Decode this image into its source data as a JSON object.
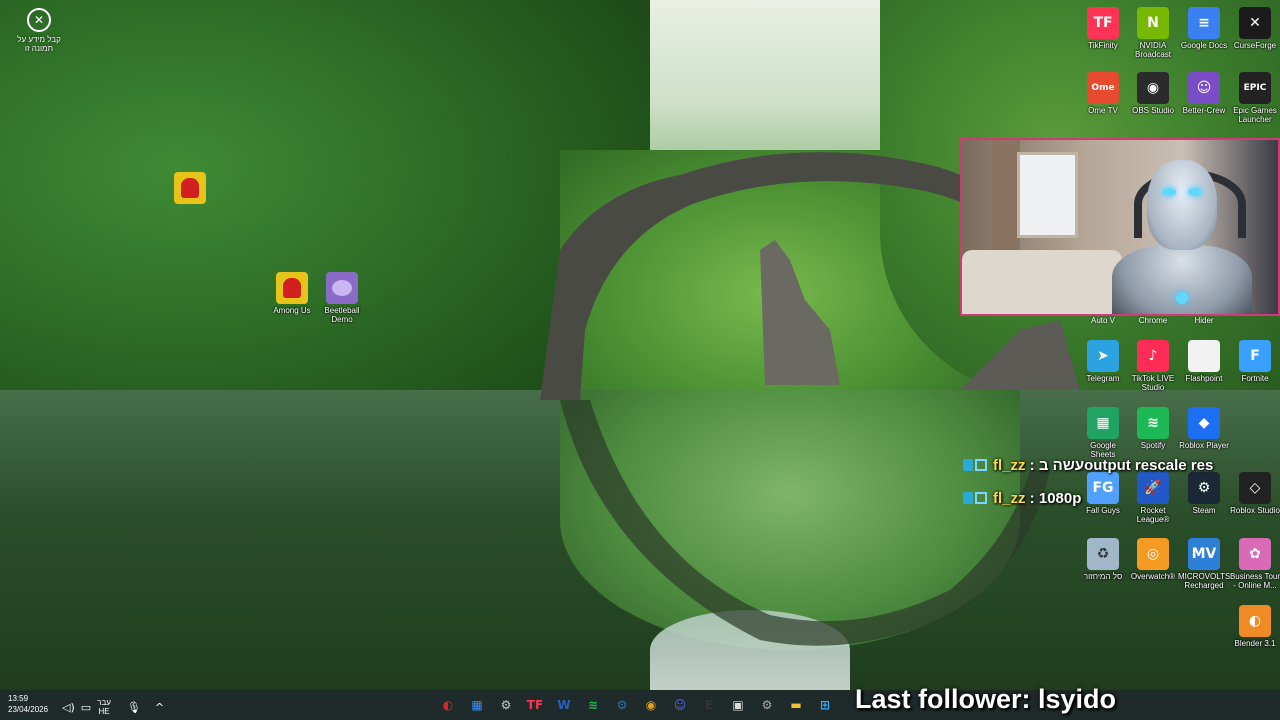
{
  "top_left_icon": {
    "icon": "circle-x-icon",
    "label_line1": "קבל מידע על",
    "label_line2": "תמונה זו"
  },
  "desktop_left": [
    {
      "label": "",
      "icon": "among-us-small-icon",
      "color": "#e8c31a"
    },
    {
      "label": "Among Us",
      "icon": "among-us-icon",
      "color": "#e8c31a"
    },
    {
      "label": "Beetleball Demo",
      "icon": "beetleball-icon",
      "color": "#8a6bc8"
    }
  ],
  "desktop_right": [
    {
      "label": "TikFinity",
      "icon": "tikfinity-icon",
      "glyph": "TF",
      "color": "#ff3355"
    },
    {
      "label": "NVIDIA Broadcast",
      "icon": "nvidia-icon",
      "glyph": "N",
      "color": "#76b900"
    },
    {
      "label": "Google Docs",
      "icon": "google-docs-icon",
      "glyph": "≡",
      "color": "#3b7ff0"
    },
    {
      "label": "CurseForge",
      "icon": "curseforge-icon",
      "glyph": "✕",
      "color": "#1b1b1b"
    },
    {
      "label": "Ome TV",
      "icon": "ome-tv-icon",
      "glyph": "Ome",
      "color": "#e84a2f"
    },
    {
      "label": "OBS Studio",
      "icon": "obs-icon",
      "glyph": "◉",
      "color": "#2b2b2b"
    },
    {
      "label": "Better-Crew",
      "icon": "better-crew-icon",
      "glyph": "☺",
      "color": "#7a4dc7"
    },
    {
      "label": "Epic Games Launcher",
      "icon": "epic-games-icon",
      "glyph": "EPIC",
      "color": "#222222"
    },
    {
      "label": "Telegram",
      "icon": "telegram-icon",
      "glyph": "➤",
      "color": "#2aa3e0"
    },
    {
      "label": "TikTok LIVE Studio",
      "icon": "tiktok-live-icon",
      "glyph": "♪",
      "color": "#ff2d55"
    },
    {
      "label": "Flashpoint",
      "icon": "flashpoint-icon",
      "glyph": "",
      "color": "#f2f2f2"
    },
    {
      "label": "Fortnite",
      "icon": "fortnite-icon",
      "glyph": "F",
      "color": "#3aa0ff"
    },
    {
      "label": "Google Sheets",
      "icon": "google-sheets-icon",
      "glyph": "▦",
      "color": "#1fa463"
    },
    {
      "label": "Spotify",
      "icon": "spotify-icon",
      "glyph": "≋",
      "color": "#1db954"
    },
    {
      "label": "Roblox Player",
      "icon": "roblox-player-icon",
      "glyph": "◆",
      "color": "#1c6ef2"
    },
    {
      "label": "Fall Guys",
      "icon": "fall-guys-icon",
      "glyph": "FG",
      "color": "#4fa0ff"
    },
    {
      "label": "Rocket League®",
      "icon": "rocket-league-icon",
      "glyph": "🚀",
      "color": "#2358c8"
    },
    {
      "label": "Steam",
      "icon": "steam-icon",
      "glyph": "⚙",
      "color": "#1b2838"
    },
    {
      "label": "Roblox Studio",
      "icon": "roblox-studio-icon",
      "glyph": "◇",
      "color": "#222222"
    },
    {
      "label": "סל המיחזור",
      "icon": "recycle-bin-icon",
      "glyph": "♻",
      "color": "#9fb7c9"
    },
    {
      "label": "Overwatch®",
      "icon": "overwatch-icon",
      "glyph": "◎",
      "color": "#f59b23"
    },
    {
      "label": "MICROVOLTS Recharged",
      "icon": "microvolts-icon",
      "glyph": "MV",
      "color": "#2d7fd8"
    },
    {
      "label": "Business Tour - Online M...",
      "icon": "business-tour-icon",
      "glyph": "✿",
      "color": "#d86ab8"
    },
    {
      "label": "Blender 3.1",
      "icon": "blender-icon",
      "glyph": "◐",
      "color": "#f08a24"
    }
  ],
  "cam_labels": [
    "Auto V",
    "Chrome",
    "Hider"
  ],
  "chat": [
    {
      "user": "fl_zz",
      "message": " : עשה בoutput rescale res"
    },
    {
      "user": "fl_zz",
      "message": " : 1080p"
    }
  ],
  "taskbar": {
    "time": "13:59",
    "date": "23/04/2026",
    "lang_line1": "עבר",
    "lang_line2": "HE",
    "apps": [
      {
        "icon": "tiktok-app-icon",
        "glyph": "◐",
        "color": "#d62b2b"
      },
      {
        "icon": "start-grid-icon",
        "glyph": "▦",
        "color": "#3b8ff0"
      },
      {
        "icon": "settings-icon",
        "glyph": "⚙",
        "color": "#cccccc"
      },
      {
        "icon": "tikfinity-app-icon",
        "glyph": "TF",
        "color": "#ff3355"
      },
      {
        "icon": "word-icon",
        "glyph": "W",
        "color": "#2b5fbf"
      },
      {
        "icon": "spotify-app-icon",
        "glyph": "≋",
        "color": "#1db954"
      },
      {
        "icon": "steam-app-icon",
        "glyph": "⚙",
        "color": "#2a6fb0"
      },
      {
        "icon": "chrome-icon",
        "glyph": "◉",
        "color": "#e4a11b"
      },
      {
        "icon": "discord-icon",
        "glyph": "☺",
        "color": "#5865f2"
      },
      {
        "icon": "epic-app-icon",
        "glyph": "E",
        "color": "#333333"
      },
      {
        "icon": "store-icon",
        "glyph": "▣",
        "color": "#dddddd"
      },
      {
        "icon": "gear-icon",
        "glyph": "⚙",
        "color": "#aaaaaa"
      },
      {
        "icon": "folder-icon",
        "glyph": "▬",
        "color": "#f3c03a"
      },
      {
        "icon": "windows-icon",
        "glyph": "⊞",
        "color": "#3fa9f5"
      }
    ]
  },
  "follower_text": "Last follower: lsyido"
}
